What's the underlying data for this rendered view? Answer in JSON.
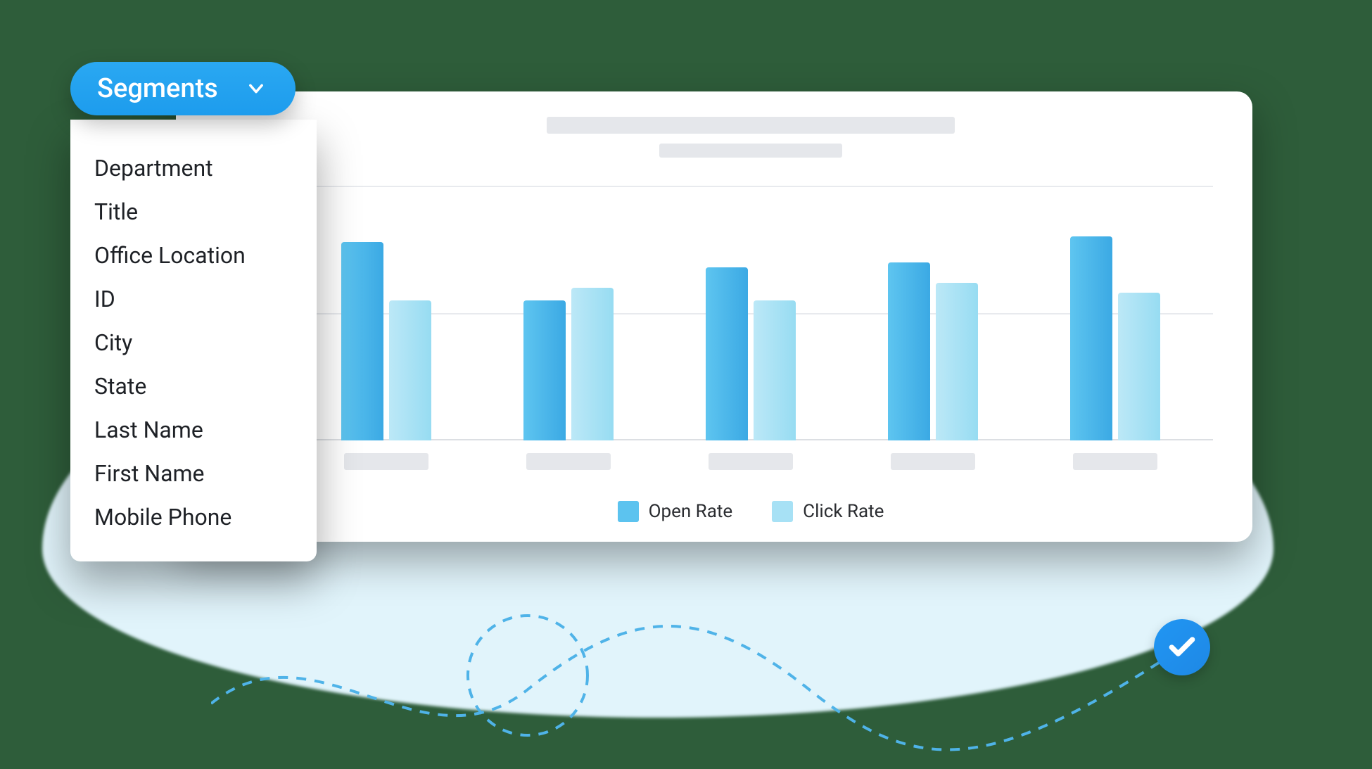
{
  "dropdown": {
    "label": "Segments",
    "items": [
      "Department",
      "Title",
      "Office Location",
      "ID",
      "City",
      "State",
      "Last Name",
      "First Name",
      "Mobile Phone"
    ]
  },
  "legend": {
    "open": "Open Rate",
    "click": "Click Rate"
  },
  "chart_data": {
    "type": "bar",
    "title": "",
    "xlabel": "",
    "ylabel": "",
    "ylim": [
      0,
      100
    ],
    "categories": [
      "",
      "",
      "",
      "",
      ""
    ],
    "series": [
      {
        "name": "Open Rate",
        "values": [
          78,
          55,
          68,
          70,
          80
        ]
      },
      {
        "name": "Click Rate",
        "values": [
          55,
          60,
          55,
          62,
          58
        ]
      }
    ]
  }
}
